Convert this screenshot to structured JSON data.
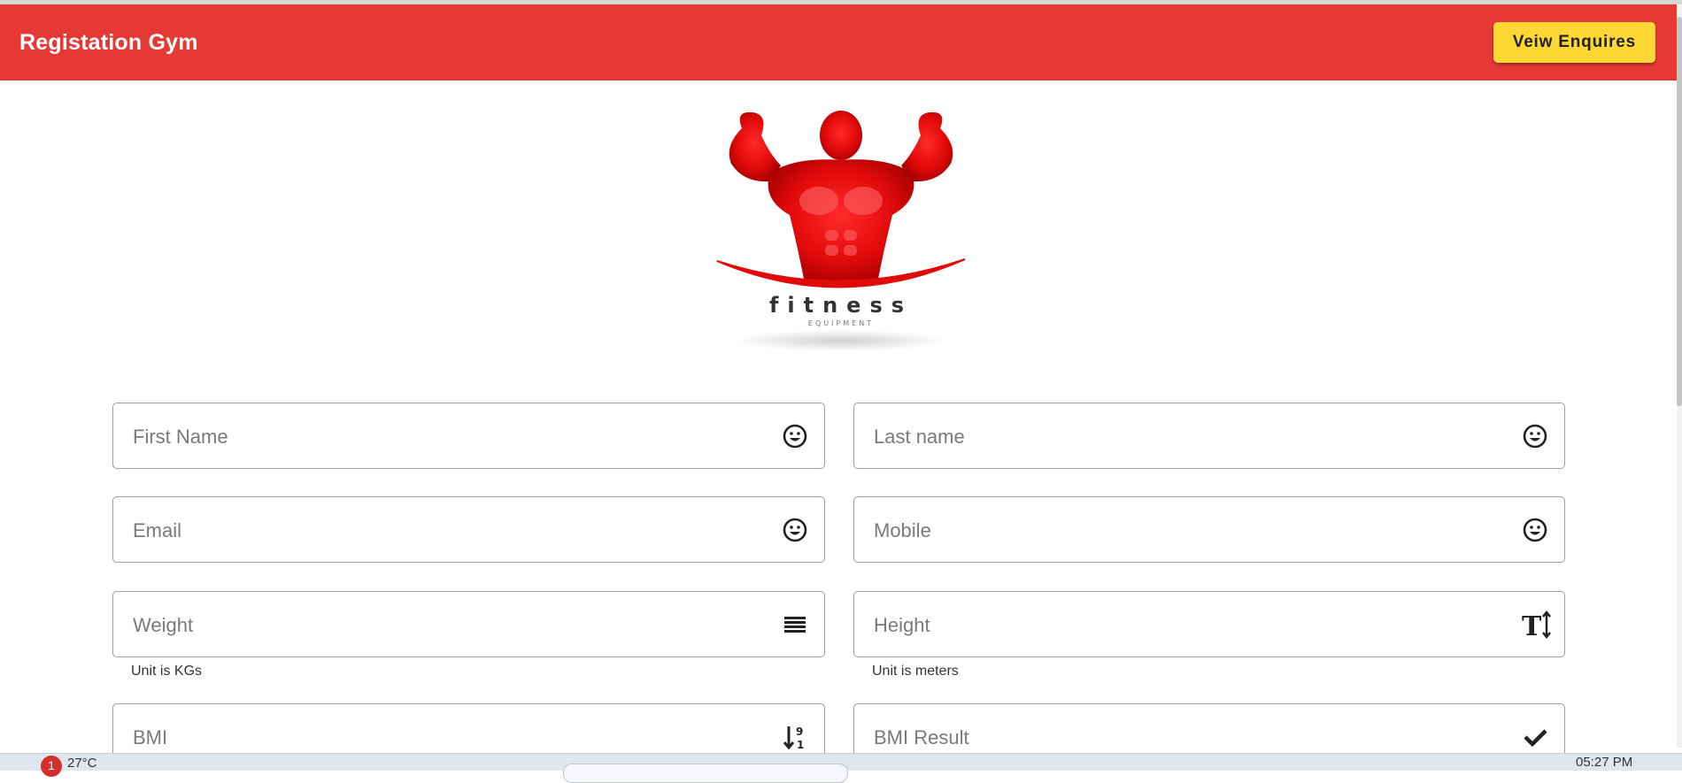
{
  "toolbar": {
    "title": "Registation Gym",
    "view_button": "Veiw Enquires"
  },
  "logo": {
    "text": "fitness",
    "subtext": "EQUIPMENT"
  },
  "form": {
    "first_name": "First Name",
    "last_name": "Last name",
    "email": "Email",
    "mobile": "Mobile",
    "weight": "Weight",
    "weight_hint": "Unit is KGs",
    "height": "Height",
    "height_hint": "Unit is meters",
    "bmi": "BMI",
    "bmi_result": "BMI Result"
  },
  "colors": {
    "primary": "#e53935",
    "accent": "#fdd835"
  },
  "icons": {
    "first_name": "smiley-icon",
    "last_name": "smiley-icon",
    "email": "smiley-icon",
    "mobile": "smiley-icon",
    "weight": "list-icon",
    "height": "text-height-icon",
    "bmi": "sort-numeric-icon",
    "bmi_result": "check-icon"
  },
  "taskbar": {
    "badge": "1",
    "temp": "27°C",
    "time": "05:27 PM"
  }
}
